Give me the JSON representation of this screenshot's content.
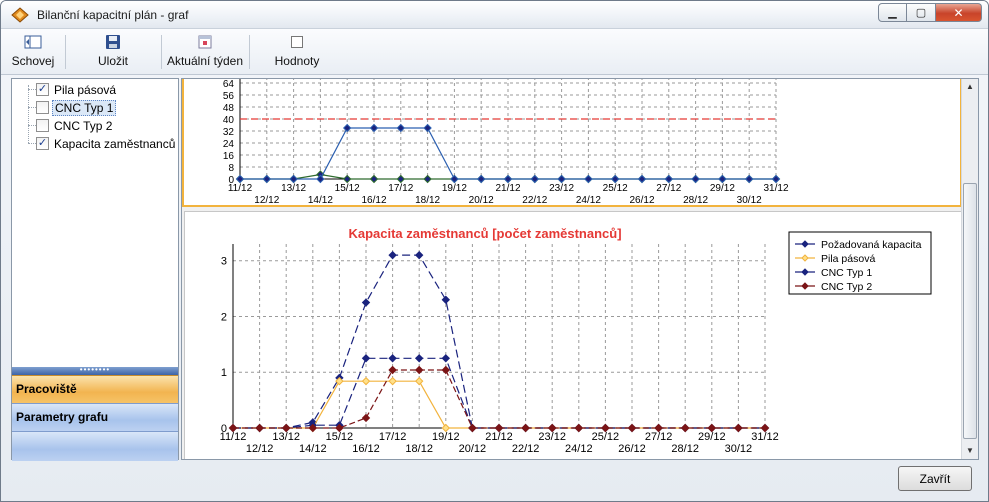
{
  "window": {
    "title": "Bilanční kapacitní plán - graf",
    "controls": {
      "minimize": "▁",
      "maximize": "▢",
      "close": "✕"
    }
  },
  "toolbar": {
    "hide_label": "Schovej",
    "save_label": "Uložit",
    "current_week_label": "Aktuální týden",
    "values_label": "Hodnoty"
  },
  "tree": {
    "items": [
      {
        "label": "Pila pásová",
        "checked": true,
        "selected": false
      },
      {
        "label": "CNC Typ 1",
        "checked": false,
        "selected": true
      },
      {
        "label": "CNC Typ 2",
        "checked": false,
        "selected": false
      },
      {
        "label": "Kapacita zaměstnanců",
        "checked": true,
        "selected": false
      }
    ]
  },
  "nav": {
    "workplace": "Pracoviště",
    "chart_params": "Parametry grafu",
    "splitter_grip": "••••••••"
  },
  "footer": {
    "close_label": "Zavřít"
  },
  "colors": {
    "required": "#1a237e",
    "pila": "#f2b33d",
    "cnc1": "#1a237e",
    "cnc2": "#7b1416",
    "limit": "#e53935",
    "title_red": "#e53935"
  },
  "chart_data": [
    {
      "type": "line",
      "title": "",
      "categories": [
        "11/12",
        "12/12",
        "13/12",
        "14/12",
        "15/12",
        "16/12",
        "17/12",
        "18/12",
        "19/12",
        "20/12",
        "21/12",
        "22/12",
        "23/12",
        "24/12",
        "25/12",
        "26/12",
        "27/12",
        "28/12",
        "29/12",
        "30/12",
        "31/12"
      ],
      "y_ticks": [
        0,
        8,
        16,
        24,
        32,
        40,
        48,
        56,
        64
      ],
      "ylim": [
        0,
        72
      ],
      "limit_line": 40,
      "grid": true,
      "series": [
        {
          "name": "",
          "values": [
            0,
            0,
            0,
            0,
            34,
            34,
            34,
            34,
            0,
            0,
            0,
            0,
            0,
            0,
            0,
            0,
            0,
            0,
            0,
            0,
            0
          ]
        },
        {
          "name": "",
          "values": [
            0,
            0,
            0,
            3,
            0,
            0,
            0,
            0,
            0,
            0,
            0,
            0,
            0,
            0,
            0,
            0,
            0,
            0,
            0,
            0,
            0
          ]
        }
      ]
    },
    {
      "type": "line",
      "title": "Kapacita zaměstnanců [počet zaměstnanců]",
      "categories": [
        "11/12",
        "12/12",
        "13/12",
        "14/12",
        "15/12",
        "16/12",
        "17/12",
        "18/12",
        "19/12",
        "20/12",
        "21/12",
        "22/12",
        "23/12",
        "24/12",
        "25/12",
        "26/12",
        "27/12",
        "28/12",
        "29/12",
        "30/12",
        "31/12"
      ],
      "y_ticks": [
        0,
        1,
        2,
        3
      ],
      "ylim": [
        0,
        3.3
      ],
      "grid": true,
      "legend": "top-right",
      "series": [
        {
          "name": "Požadovaná kapacita",
          "values": [
            0,
            0,
            0,
            0.1,
            0.9,
            2.25,
            3.1,
            3.1,
            2.3,
            0,
            0,
            0,
            0,
            0,
            0,
            0,
            0,
            0,
            0,
            0,
            0
          ]
        },
        {
          "name": "Pila pásová",
          "values": [
            0,
            0,
            0,
            0,
            0.84,
            0.84,
            0.84,
            0.84,
            0,
            0,
            0,
            0,
            0,
            0,
            0,
            0,
            0,
            0,
            0,
            0,
            0
          ]
        },
        {
          "name": "CNC Typ 1",
          "values": [
            0,
            0,
            0,
            0.05,
            0.05,
            1.25,
            1.25,
            1.25,
            1.25,
            0,
            0,
            0,
            0,
            0,
            0,
            0,
            0,
            0,
            0,
            0,
            0
          ]
        },
        {
          "name": "CNC Typ 2",
          "values": [
            0,
            0,
            0,
            0,
            0,
            0.18,
            1.04,
            1.04,
            1.04,
            0,
            0,
            0,
            0,
            0,
            0,
            0,
            0,
            0,
            0,
            0,
            0
          ]
        }
      ]
    }
  ]
}
